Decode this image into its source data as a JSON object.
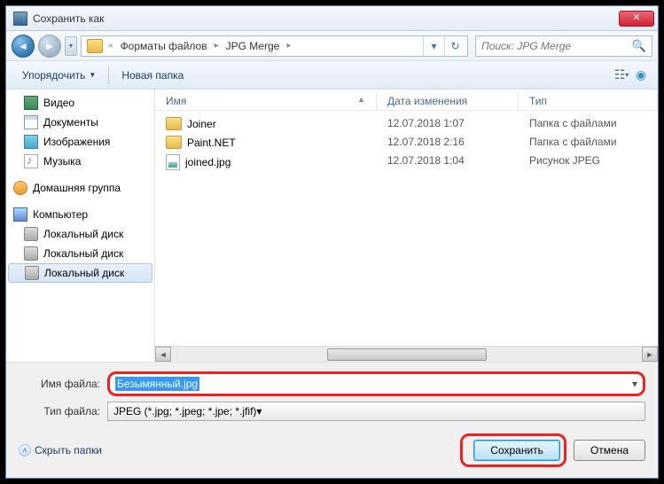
{
  "title": "Сохранить как",
  "breadcrumb": {
    "sep0": "«",
    "item1": "Форматы файлов",
    "item2": "JPG Merge"
  },
  "search": {
    "placeholder": "Поиск: JPG Merge"
  },
  "toolbar": {
    "organize": "Упорядочить",
    "newfolder": "Новая папка"
  },
  "sidebar": {
    "items": [
      {
        "label": "Видео"
      },
      {
        "label": "Документы"
      },
      {
        "label": "Изображения"
      },
      {
        "label": "Музыка"
      }
    ],
    "homegroup": "Домашняя группа",
    "computer": "Компьютер",
    "disks": [
      {
        "label": "Локальный диск"
      },
      {
        "label": "Локальный диск"
      },
      {
        "label": "Локальный диск"
      }
    ]
  },
  "columns": {
    "name": "Имя",
    "date": "Дата изменения",
    "type": "Тип"
  },
  "files": [
    {
      "name": "Joiner",
      "date": "12.07.2018 1:07",
      "type": "Папка с файлами",
      "kind": "folder"
    },
    {
      "name": "Paint.NET",
      "date": "12.07.2018 2:16",
      "type": "Папка с файлами",
      "kind": "folder"
    },
    {
      "name": "joined.jpg",
      "date": "12.07.2018 1:04",
      "type": "Рисунок JPEG",
      "kind": "jpg"
    }
  ],
  "fields": {
    "filename_label": "Имя файла:",
    "filename_value": "Безымянный.jpg",
    "filetype_label": "Тип файла:",
    "filetype_value": "JPEG (*.jpg; *.jpeg; *.jpe; *.jfif)"
  },
  "buttons": {
    "hide": "Скрыть папки",
    "save": "Сохранить",
    "cancel": "Отмена"
  }
}
